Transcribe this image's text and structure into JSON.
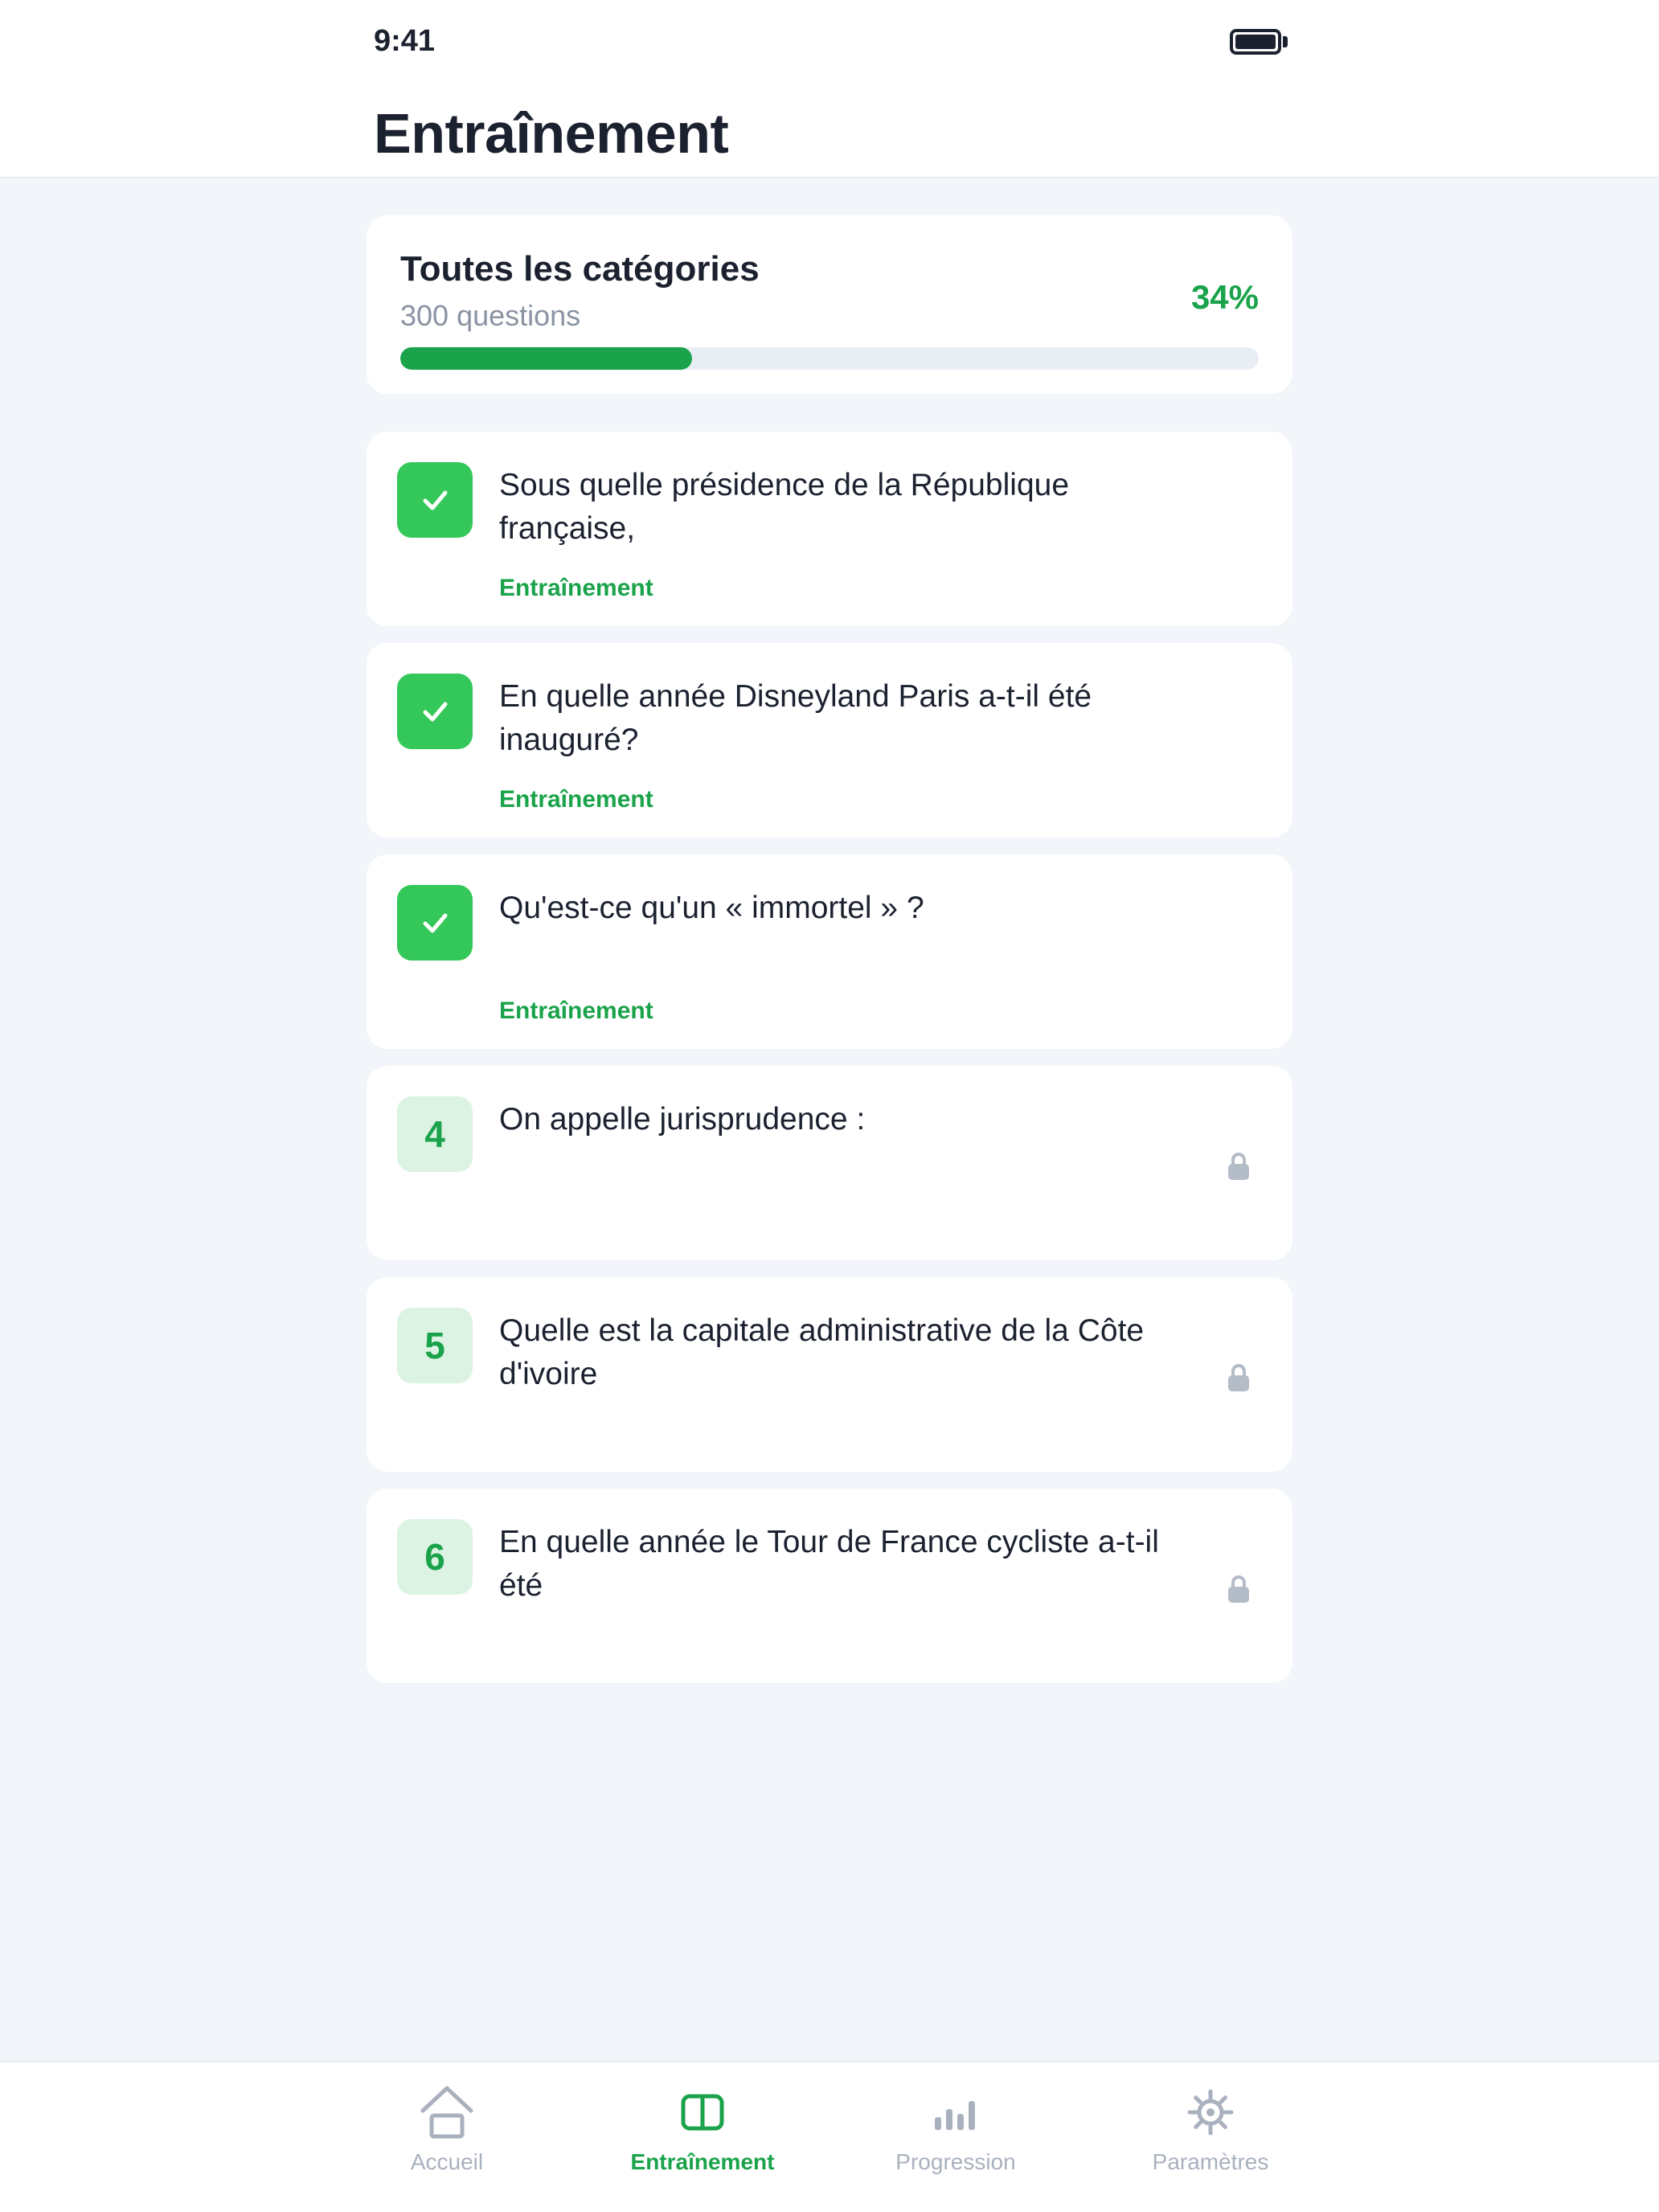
{
  "status_bar": {
    "time": "9:41"
  },
  "header": {
    "title": "Entraînement"
  },
  "summary": {
    "title": "Toutes les catégories",
    "subtitle": "300 questions",
    "percent_label": "34%",
    "progress": 0.34
  },
  "questions": [
    {
      "badge": "",
      "state": "done",
      "text": "Sous quelle présidence de la République française,",
      "tag": "Entraînement"
    },
    {
      "badge": "",
      "state": "done",
      "text": "En quelle année Disneyland Paris a-t-il été inauguré?",
      "tag": "Entraînement"
    },
    {
      "badge": "",
      "state": "done",
      "text": "Qu'est-ce qu'un « immortel » ?",
      "tag": "Entraînement"
    },
    {
      "badge": "4",
      "state": "locked",
      "text": "On appelle jurisprudence :",
      "tag": ""
    },
    {
      "badge": "5",
      "state": "locked",
      "text": "Quelle est la capitale administrative de la Côte d'ivoire",
      "tag": ""
    },
    {
      "badge": "6",
      "state": "locked",
      "text": "En quelle année le Tour de France cycliste a-t-il été",
      "tag": ""
    }
  ],
  "tabbar": {
    "items": [
      {
        "label": "Accueil",
        "icon": "home-icon",
        "active": false
      },
      {
        "label": "Entraînement",
        "icon": "book-icon",
        "active": true
      },
      {
        "label": "Progression",
        "icon": "bar-chart-icon",
        "active": false
      },
      {
        "label": "Paramètres",
        "icon": "gear-icon",
        "active": false
      }
    ]
  },
  "colors": {
    "accent": "#1aa34a",
    "check_badge": "#34c759",
    "locked_badge": "#dcf3e3",
    "inactive": "#a9b1be",
    "background": "#f2f5f9"
  }
}
